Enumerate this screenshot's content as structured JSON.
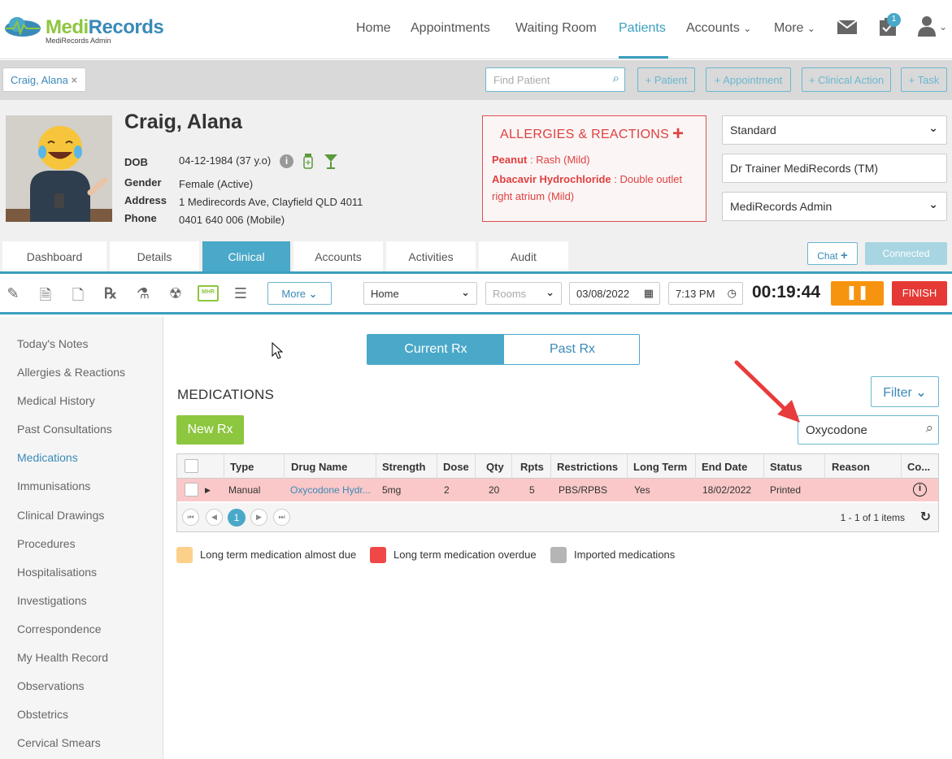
{
  "brand": {
    "name": "MediRecords",
    "sub": "MediRecords Admin"
  },
  "nav": {
    "home": "Home",
    "appointments": "Appointments",
    "waiting_room": "Waiting Room",
    "patients": "Patients",
    "accounts": "Accounts",
    "more": "More",
    "task_badge": "1"
  },
  "patient_bar": {
    "tab_label": "Craig, Alana",
    "find_placeholder": "Find Patient",
    "buttons": [
      "+ Patient",
      "+ Appointment",
      "+ Clinical Action",
      "+ Task"
    ]
  },
  "patient": {
    "name": "Craig, Alana",
    "dob_label": "DOB",
    "dob": "04-12-1984 (37 y.o)",
    "gender_label": "Gender",
    "gender": "Female (Active)",
    "address_label": "Address",
    "address": "1 Medirecords Ave, Clayfield QLD 4011",
    "phone_label": "Phone",
    "phone": "0401 640 006 (Mobile)"
  },
  "allergies": {
    "title": "ALLERGIES & REACTIONS",
    "items": [
      {
        "name": "Peanut",
        "reaction": "Rash (Mild)"
      },
      {
        "name": "Abacavir Hydrochloride",
        "reaction": "Double outlet right atrium (Mild)"
      }
    ]
  },
  "selects": {
    "billing": "Standard",
    "provider": "Dr Trainer MediRecords (TM)",
    "location": "MediRecords Admin"
  },
  "main_tabs": [
    "Dashboard",
    "Details",
    "Clinical",
    "Accounts",
    "Activities",
    "Audit"
  ],
  "chat": {
    "chat_label": "Chat",
    "connected_label": "Connected"
  },
  "toolbar": {
    "more_label": "More",
    "location_select": "Home",
    "rooms_placeholder": "Rooms",
    "date": "03/08/2022",
    "time": "7:13 PM",
    "timer": "00:19:44",
    "finish_label": "FINISH"
  },
  "sidebar": {
    "items": [
      "Today's Notes",
      "Allergies & Reactions",
      "Medical History",
      "Past Consultations",
      "Medications",
      "Immunisations",
      "Clinical Drawings",
      "Procedures",
      "Hospitalisations",
      "Investigations",
      "Correspondence",
      "My Health Record",
      "Observations",
      "Obstetrics",
      "Cervical Smears"
    ],
    "active": "Medications"
  },
  "rx_toggle": {
    "current": "Current Rx",
    "past": "Past Rx"
  },
  "medications": {
    "title": "MEDICATIONS",
    "new_rx": "New Rx",
    "filter": "Filter",
    "search_value": "Oxycodone",
    "columns": [
      "Type",
      "Drug Name",
      "Strength",
      "Dose",
      "Qty",
      "Rpts",
      "Restrictions",
      "Long Term",
      "End Date",
      "Status",
      "Reason",
      "Co..."
    ],
    "rows": [
      {
        "type": "Manual",
        "drug": "Oxycodone Hydr...",
        "strength": "5mg",
        "dose": "2",
        "qty": "20",
        "rpts": "5",
        "restrictions": "PBS/RPBS",
        "long_term": "Yes",
        "end_date": "18/02/2022",
        "status": "Printed",
        "reason": ""
      }
    ],
    "page": "1",
    "items_text": "1 - 1 of 1 items"
  },
  "legend": [
    {
      "label": "Long term medication almost due",
      "color": "#fdd08a"
    },
    {
      "label": "Long term medication overdue",
      "color": "#f04747"
    },
    {
      "label": "Imported medications",
      "color": "#b5b5b5"
    }
  ]
}
